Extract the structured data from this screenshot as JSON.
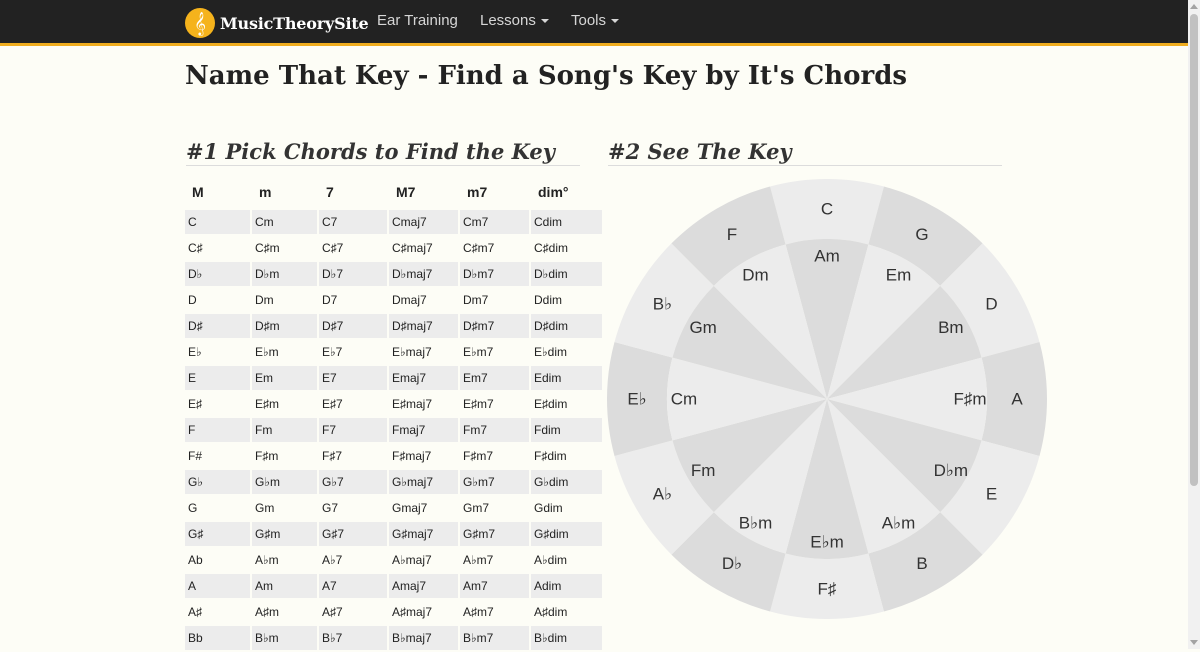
{
  "navbar": {
    "brand": "MusicTheorySite",
    "logo_glyph": "𝄞",
    "links": [
      {
        "label": "Ear Training",
        "dropdown": false
      },
      {
        "label": "Lessons",
        "dropdown": true
      },
      {
        "label": "Tools",
        "dropdown": true
      }
    ]
  },
  "page": {
    "title": "Name That Key - Find a Song's Key by It's Chords",
    "section1_title": "#1 Pick Chords to Find the Key",
    "section2_title": "#2 See The Key"
  },
  "chord_table": {
    "headers": [
      "M",
      "m",
      "7",
      "M7",
      "m7",
      "dim°"
    ],
    "rows": [
      [
        "C",
        "Cm",
        "C7",
        "Cmaj7",
        "Cm7",
        "Cdim"
      ],
      [
        "C♯",
        "C♯m",
        "C♯7",
        "C♯maj7",
        "C♯m7",
        "C♯dim"
      ],
      [
        "D♭",
        "D♭m",
        "D♭7",
        "D♭maj7",
        "D♭m7",
        "D♭dim"
      ],
      [
        "D",
        "Dm",
        "D7",
        "Dmaj7",
        "Dm7",
        "Ddim"
      ],
      [
        "D♯",
        "D♯m",
        "D♯7",
        "D♯maj7",
        "D♯m7",
        "D♯dim"
      ],
      [
        "E♭",
        "E♭m",
        "E♭7",
        "E♭maj7",
        "E♭m7",
        "E♭dim"
      ],
      [
        "E",
        "Em",
        "E7",
        "Emaj7",
        "Em7",
        "Edim"
      ],
      [
        "E♯",
        "E♯m",
        "E♯7",
        "E♯maj7",
        "E♯m7",
        "E♯dim"
      ],
      [
        "F",
        "Fm",
        "F7",
        "Fmaj7",
        "Fm7",
        "Fdim"
      ],
      [
        "F#",
        "F♯m",
        "F♯7",
        "F♯maj7",
        "F♯m7",
        "F♯dim"
      ],
      [
        "G♭",
        "G♭m",
        "G♭7",
        "G♭maj7",
        "G♭m7",
        "G♭dim"
      ],
      [
        "G",
        "Gm",
        "G7",
        "Gmaj7",
        "Gm7",
        "Gdim"
      ],
      [
        "G♯",
        "G♯m",
        "G♯7",
        "G♯maj7",
        "G♯m7",
        "G♯dim"
      ],
      [
        "Ab",
        "A♭m",
        "A♭7",
        "A♭maj7",
        "A♭m7",
        "A♭dim"
      ],
      [
        "A",
        "Am",
        "A7",
        "Amaj7",
        "Am7",
        "Adim"
      ],
      [
        "A♯",
        "A♯m",
        "A♯7",
        "A♯maj7",
        "A♯m7",
        "A♯dim"
      ],
      [
        "Bb",
        "B♭m",
        "B♭7",
        "B♭maj7",
        "B♭m7",
        "B♭dim"
      ]
    ]
  },
  "circle_of_fifths": {
    "major": [
      "C",
      "G",
      "D",
      "A",
      "E",
      "B",
      "F♯",
      "D♭",
      "A♭",
      "E♭",
      "B♭",
      "F"
    ],
    "minor": [
      "Am",
      "Em",
      "Bm",
      "F♯m",
      "D♭m",
      "A♭m",
      "E♭m",
      "B♭m",
      "Fm",
      "Cm",
      "Gm",
      "Dm"
    ],
    "colors": {
      "light": "#ececec",
      "dark": "#dcdcdc"
    }
  }
}
